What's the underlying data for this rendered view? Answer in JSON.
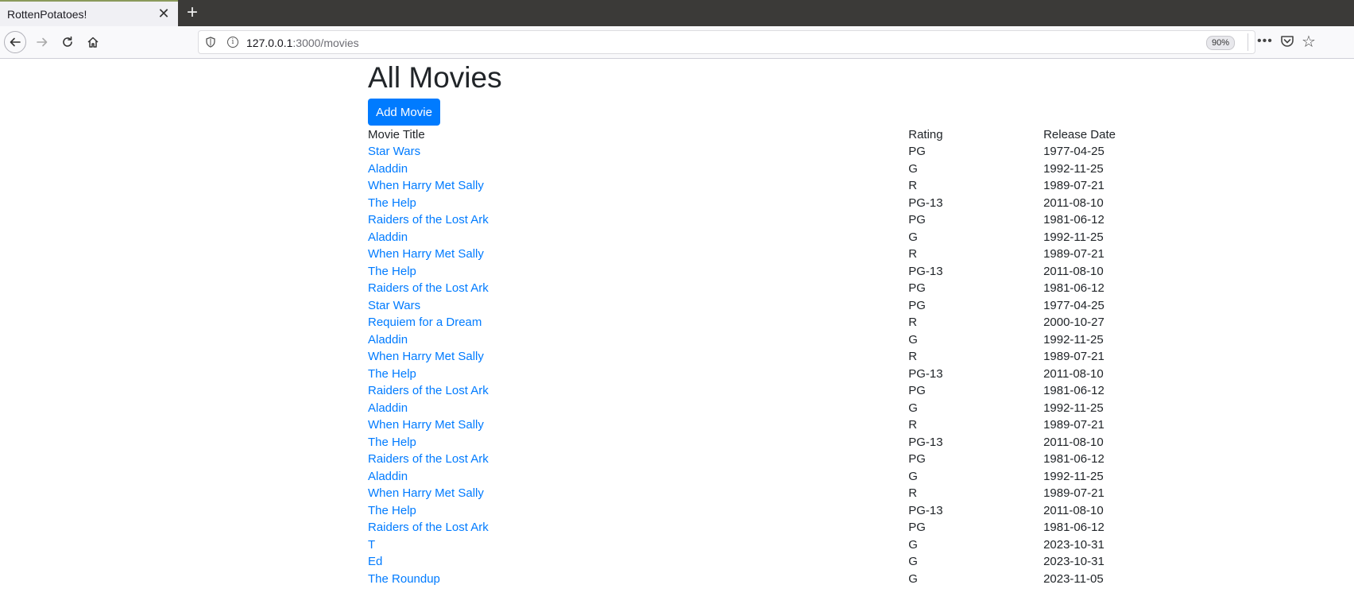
{
  "browser": {
    "tab_title": "RottenPotatoes!",
    "tab_close": "✕",
    "new_tab": "+",
    "url_host": "127.0.0.1",
    "url_path": ":3000/movies",
    "zoom": "90%",
    "menu": "•••"
  },
  "page": {
    "title": "All Movies",
    "add_button": "Add Movie"
  },
  "table": {
    "headers": [
      "Movie Title",
      "Rating",
      "Release Date"
    ],
    "rows": [
      {
        "title": "Star Wars",
        "rating": "PG",
        "date": "1977-04-25"
      },
      {
        "title": "Aladdin",
        "rating": "G",
        "date": "1992-11-25"
      },
      {
        "title": "When Harry Met Sally",
        "rating": "R",
        "date": "1989-07-21"
      },
      {
        "title": "The Help",
        "rating": "PG-13",
        "date": "2011-08-10"
      },
      {
        "title": "Raiders of the Lost Ark",
        "rating": "PG",
        "date": "1981-06-12"
      },
      {
        "title": "Aladdin",
        "rating": "G",
        "date": "1992-11-25"
      },
      {
        "title": "When Harry Met Sally",
        "rating": "R",
        "date": "1989-07-21"
      },
      {
        "title": "The Help",
        "rating": "PG-13",
        "date": "2011-08-10"
      },
      {
        "title": "Raiders of the Lost Ark",
        "rating": "PG",
        "date": "1981-06-12"
      },
      {
        "title": "Star Wars",
        "rating": "PG",
        "date": "1977-04-25"
      },
      {
        "title": "Requiem for a Dream",
        "rating": "R",
        "date": "2000-10-27"
      },
      {
        "title": "Aladdin",
        "rating": "G",
        "date": "1992-11-25"
      },
      {
        "title": "When Harry Met Sally",
        "rating": "R",
        "date": "1989-07-21"
      },
      {
        "title": "The Help",
        "rating": "PG-13",
        "date": "2011-08-10"
      },
      {
        "title": "Raiders of the Lost Ark",
        "rating": "PG",
        "date": "1981-06-12"
      },
      {
        "title": "Aladdin",
        "rating": "G",
        "date": "1992-11-25"
      },
      {
        "title": "When Harry Met Sally",
        "rating": "R",
        "date": "1989-07-21"
      },
      {
        "title": "The Help",
        "rating": "PG-13",
        "date": "2011-08-10"
      },
      {
        "title": "Raiders of the Lost Ark",
        "rating": "PG",
        "date": "1981-06-12"
      },
      {
        "title": "Aladdin",
        "rating": "G",
        "date": "1992-11-25"
      },
      {
        "title": "When Harry Met Sally",
        "rating": "R",
        "date": "1989-07-21"
      },
      {
        "title": "The Help",
        "rating": "PG-13",
        "date": "2011-08-10"
      },
      {
        "title": "Raiders of the Lost Ark",
        "rating": "PG",
        "date": "1981-06-12"
      },
      {
        "title": "T",
        "rating": "G",
        "date": "2023-10-31"
      },
      {
        "title": "Ed",
        "rating": "G",
        "date": "2023-10-31"
      },
      {
        "title": "The Roundup",
        "rating": "G",
        "date": "2023-11-05"
      }
    ]
  },
  "colors": {
    "link": "#007bff",
    "button_bg": "#007bff",
    "text": "#212529"
  }
}
